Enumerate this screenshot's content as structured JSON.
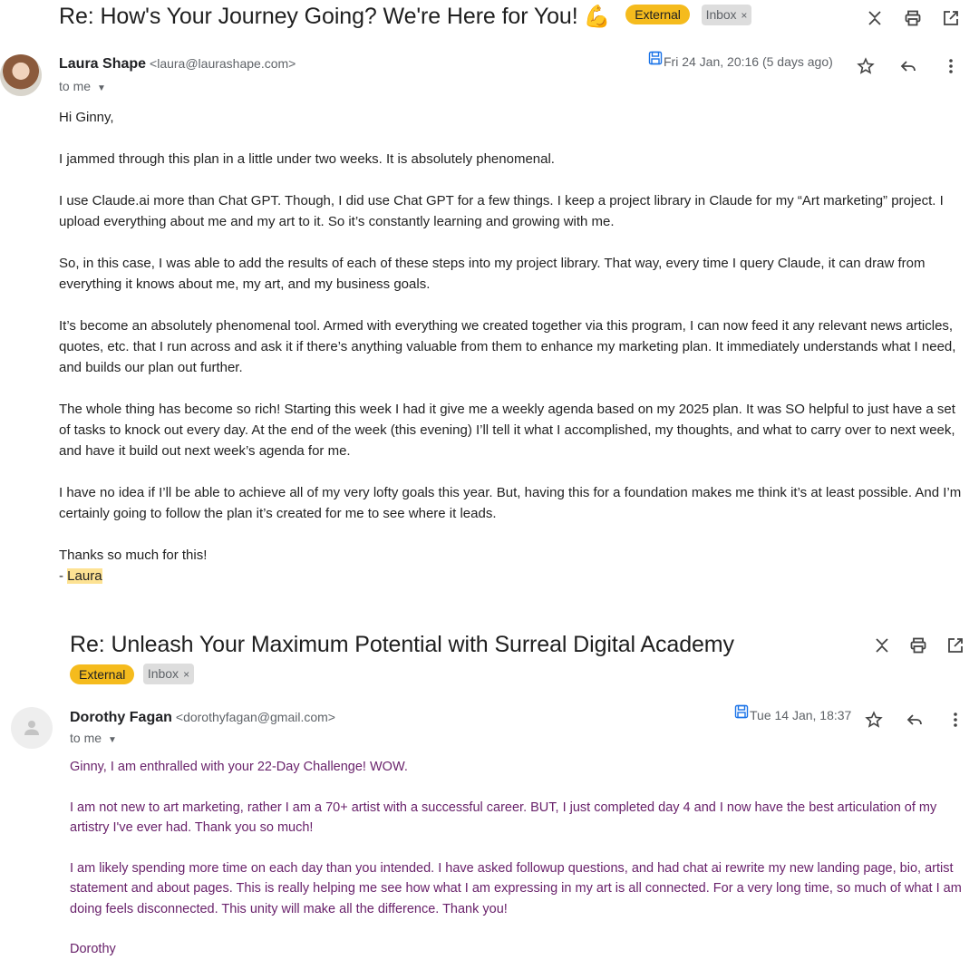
{
  "email1": {
    "subject": "Re: How's Your Journey Going? We're Here for You!",
    "subject_emoji": "💪",
    "labels": {
      "external": "External",
      "inbox": "Inbox",
      "remove": "×"
    },
    "sender_name": "Laura Shape",
    "sender_email": "<laura@laurashape.com>",
    "to": "to me",
    "date": "Fri 24 Jan, 20:16 (5 days ago)",
    "body": {
      "greeting": "Hi Ginny,",
      "p1": "I jammed through this plan in a little under two weeks. It is absolutely phenomenal.",
      "p2": "I use Claude.ai more than Chat GPT. Though, I did use Chat GPT for a few things. I keep a project library in Claude for my “Art marketing” project. I upload everything about me and my art to it. So it’s constantly learning and growing with me.",
      "p3": "So, in this case, I was able to add the results of each of these steps into my project library. That way, every time I query Claude, it can draw from everything it knows about me, my art, and my business goals.",
      "p4": "It’s become an absolutely phenomenal tool. Armed with everything we created together via this program, I can now feed it any relevant news articles, quotes, etc. that I run across and ask it if there’s anything valuable from them to enhance my marketing plan. It immediately understands what I need, and builds our plan out further.",
      "p5": "The whole thing has become so rich! Starting this week I had it give me a weekly agenda based on my 2025 plan. It was SO helpful to just have a set of tasks to knock out every day. At the end of the week (this evening) I’ll tell it what I accomplished, my thoughts, and what to carry over to next week, and have it build out next week’s agenda for me.",
      "p6": "I have no idea if I’ll be able to achieve all of my very lofty goals this year. But, having this for a foundation makes me think it’s at least possible. And I’m certainly going to follow the plan it’s created for me to see where it leads.",
      "closing": "Thanks so much for this!",
      "sign_dash": "- ",
      "sign_name": "Laura"
    }
  },
  "email2": {
    "subject": "Re: Unleash Your Maximum Potential with Surreal Digital Academy",
    "labels": {
      "external": "External",
      "inbox": "Inbox",
      "remove": "×"
    },
    "sender_name": "Dorothy Fagan",
    "sender_email": "<dorothyfagan@gmail.com>",
    "to": "to me",
    "date": "Tue 14 Jan, 18:37",
    "body": {
      "p1": "Ginny, I am enthralled with your 22-Day Challenge! WOW.",
      "p2": "I am not new to art marketing, rather I am a 70+ artist with a successful career. BUT, I just completed day 4 and I now have the best articulation of my artistry I've ever had. Thank you so much!",
      "p3": "I am likely spending more time on each day than you intended. I have asked followup questions, and had chat ai rewrite my new landing page, bio, artist statement and about pages. This is really helping me see how what I am expressing in my art is all connected. For a very long time, so much of what I am doing feels disconnected. This unity will make all the difference. Thank you!",
      "p4": "Dorothy"
    }
  },
  "icons": {
    "collapse": "collapse-all-icon",
    "print": "print-icon",
    "open_new": "open-in-new-window-icon",
    "star": "star-icon",
    "reply": "reply-icon",
    "more": "more-vert-icon",
    "saved": "saved-disk-icon",
    "caret": "chevron-down-icon"
  },
  "colors": {
    "external_label": "#f5bb1d",
    "inbox_label": "#dddddd",
    "quoted_text": "#69226b",
    "highlight": "#fde293"
  }
}
